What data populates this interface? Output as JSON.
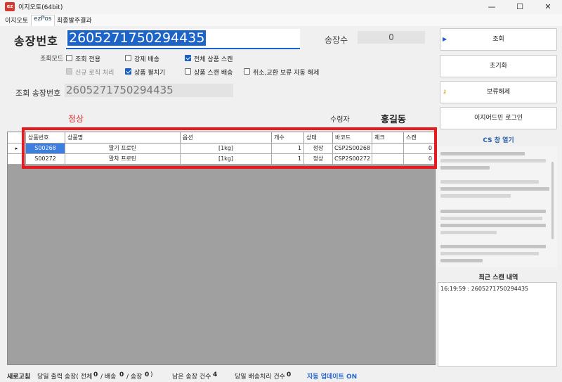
{
  "window": {
    "title": "이지오토(64bit)",
    "minimize": "—",
    "maximize": "☐",
    "close": "✕"
  },
  "menu": {
    "items": [
      "이지오토",
      "ezPos",
      "최종발주결과"
    ]
  },
  "header": {
    "invoice_label": "송장번호",
    "invoice_value": "2605271750294435",
    "count_label": "송장수",
    "count_value": "0",
    "mode_label": "조회모드",
    "options": [
      {
        "label": "조회 전용",
        "checked": false
      },
      {
        "label": "강제 배송",
        "checked": false
      },
      {
        "label": "전체 상품 스캔",
        "checked": true
      },
      {
        "label": "신규 로직 처리",
        "checked": false,
        "disabled": true
      },
      {
        "label": "상품 펼치기",
        "checked": true
      },
      {
        "label": "상품 스캔 배송",
        "checked": false
      },
      {
        "label": "취소,교환 보류 자동 해제",
        "checked": false
      }
    ],
    "query_label": "조회 송장번호",
    "query_value": "2605271750294435",
    "status": "정상",
    "recipient_label": "수령자",
    "recipient_name": "홍길동"
  },
  "grid": {
    "columns": [
      "상품번호",
      "상품명",
      "옵션",
      "개수",
      "상태",
      "바코드",
      "체크",
      "스캔"
    ],
    "current_row_marker": "▸",
    "rows": [
      [
        "S00268",
        "딸기 프로틴",
        "[1kg]",
        "1",
        "정상",
        "CSP2S00268",
        "",
        "0"
      ],
      [
        "S00272",
        "말차 프로틴",
        "[1kg]",
        "1",
        "정상",
        "CSP2S00272",
        "",
        "0"
      ]
    ]
  },
  "side": {
    "buttons": [
      "조회",
      "초기화",
      "보류해제",
      "이지어드민 로그인"
    ],
    "cs_title": "CS 창 열기",
    "recent_title": "최근 스캔 내역",
    "recent_items": [
      "16:19:59 :  2605271750294435"
    ]
  },
  "statusbar": {
    "refresh": "새로고침",
    "today_label": "당일 출력 송장( 전체",
    "today_total": "0",
    "ship_label": "/ 배송",
    "ship_count": "0",
    "invoice_label": "/ 송장",
    "invoice_count": "0",
    "close_paren": ")",
    "remaining_label": "남은 송장 건수",
    "remaining_count": "4",
    "processed_label": "당일 배송처리 건수",
    "processed_count": "0",
    "auto_update": "자동 업데이트 ON"
  },
  "colors": {
    "accent": "#1c64c8",
    "status_ok": "#e03030",
    "highlight": "#e8191f"
  }
}
